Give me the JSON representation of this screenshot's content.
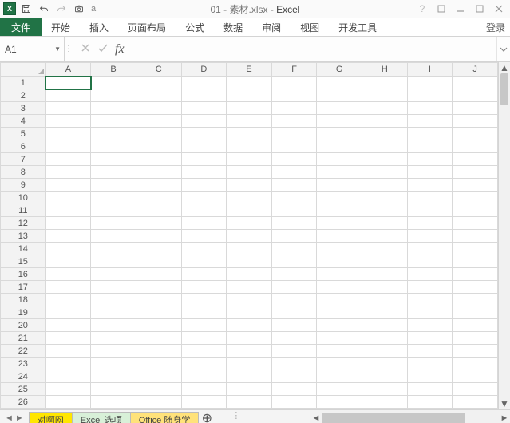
{
  "title": {
    "filename": "01 - 素材.xlsx",
    "app": "Excel",
    "sep": " - "
  },
  "qat": {
    "qmore": "a"
  },
  "ribbon": {
    "file": "文件",
    "tabs": [
      "开始",
      "插入",
      "页面布局",
      "公式",
      "数据",
      "审阅",
      "视图",
      "开发工具"
    ],
    "signin": "登录"
  },
  "formula_bar": {
    "cell_ref": "A1",
    "fx_label": "fx",
    "value": ""
  },
  "grid": {
    "columns": [
      "A",
      "B",
      "C",
      "D",
      "E",
      "F",
      "G",
      "H",
      "I",
      "J"
    ],
    "row_count": 27,
    "selected": {
      "row": 1,
      "col": 1
    }
  },
  "sheets": {
    "tabs": [
      {
        "name": "对啊网",
        "color": "c1"
      },
      {
        "name": "Excel 选项",
        "color": "c2"
      },
      {
        "name": "Office 随身学",
        "color": "c3"
      }
    ],
    "add_label": "+"
  },
  "chart_data": null
}
